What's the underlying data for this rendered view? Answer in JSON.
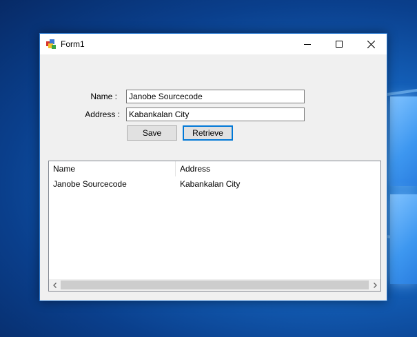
{
  "window": {
    "title": "Form1",
    "minimize_icon": "minimize-icon",
    "maximize_icon": "maximize-icon",
    "close_icon": "close-icon"
  },
  "form": {
    "name_label": "Name :",
    "name_value": "Janobe Sourcecode",
    "address_label": "Address :",
    "address_value": "Kabankalan City",
    "save_label": "Save",
    "retrieve_label": "Retrieve"
  },
  "listview": {
    "columns": [
      "Name",
      "Address"
    ],
    "rows": [
      [
        "Janobe Sourcecode",
        "Kabankalan City"
      ]
    ]
  },
  "colors": {
    "accent": "#0078d7",
    "window_bg": "#f0f0f0",
    "desktop": "#1565c0"
  }
}
